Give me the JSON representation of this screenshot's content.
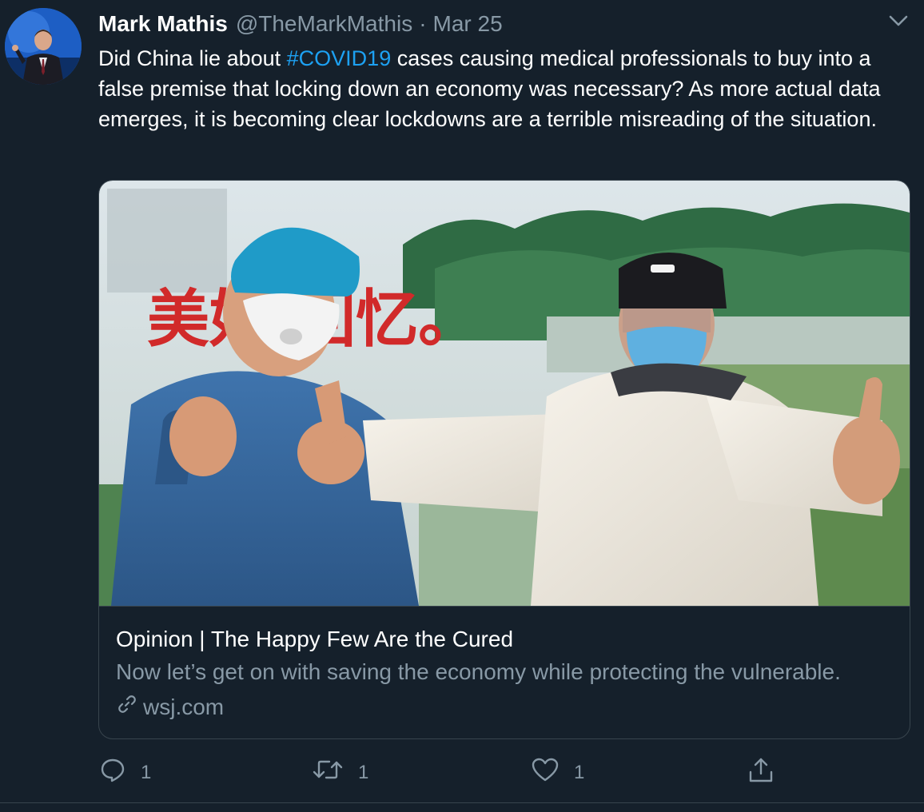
{
  "tweet": {
    "author_name": "Mark Mathis",
    "handle": "@TheMarkMathis",
    "separator": "·",
    "date": "Mar 25",
    "text_before": "Did China lie about ",
    "hashtag": "#COVID19",
    "text_after": " cases causing medical professionals to buy into a false premise that locking down an economy was necessary? As more actual data emerges, it is becoming clear lockdowns are a terrible misreading of the situation."
  },
  "card": {
    "title": "Opinion | The Happy Few Are the Cured",
    "description": "Now let’s get on with saving the economy while protecting the vulnerable.",
    "domain": "wsj.com",
    "banner_characters": "美好 回忆。"
  },
  "actions": {
    "reply_count": "1",
    "retweet_count": "1",
    "like_count": "1"
  },
  "colors": {
    "background": "#15202b",
    "text": "#ffffff",
    "secondary": "#8899a6",
    "accent": "#1da1f2",
    "border": "#38444d"
  },
  "icons": [
    "caret-down-icon",
    "link-icon",
    "reply-icon",
    "retweet-icon",
    "like-icon",
    "share-icon"
  ]
}
